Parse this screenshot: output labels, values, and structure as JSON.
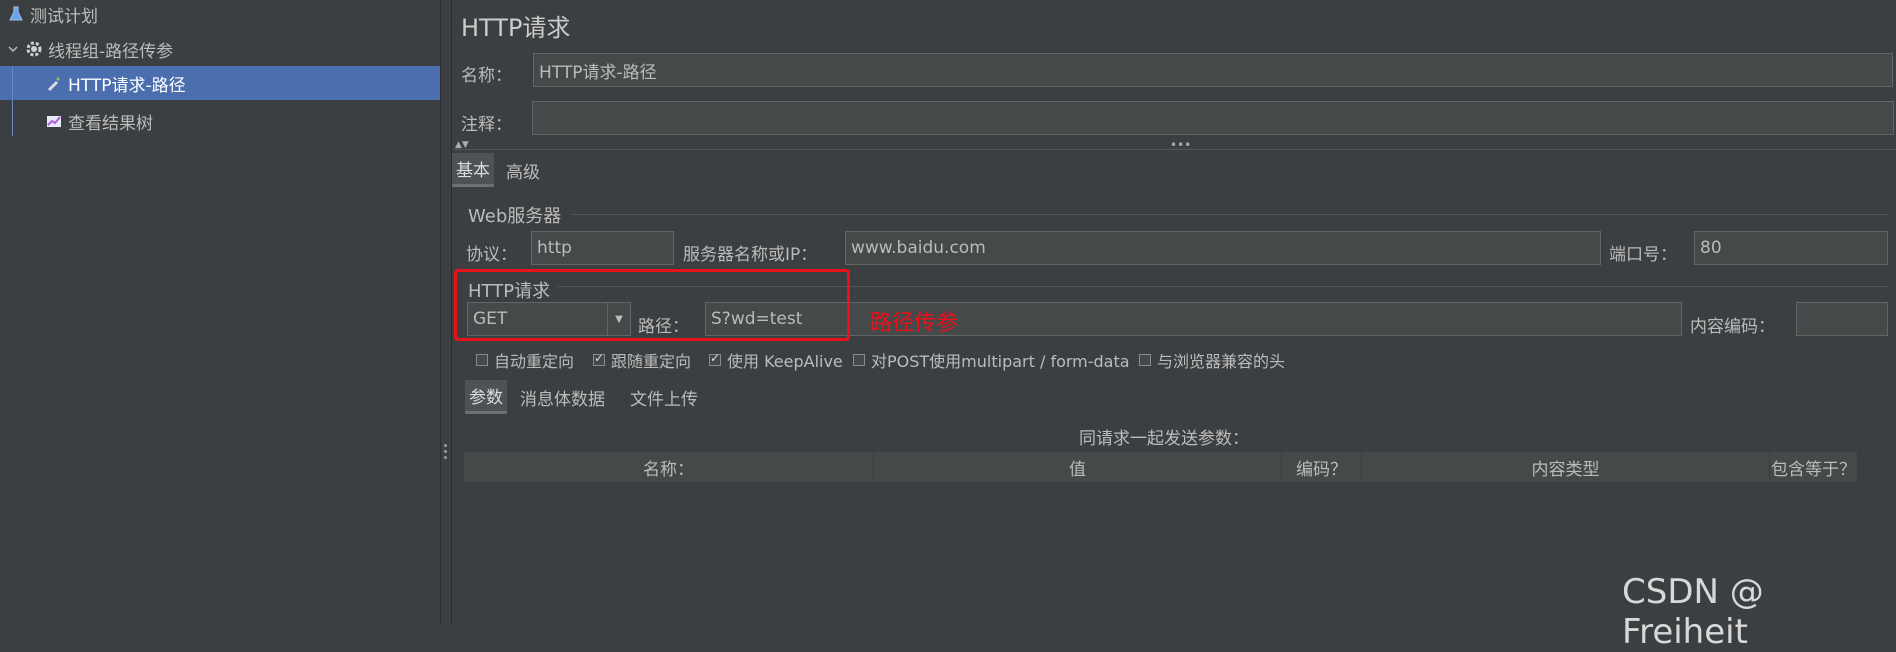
{
  "tree": {
    "items": [
      {
        "label": "测试计划",
        "icon": "flask-icon"
      },
      {
        "label": "线程组-路径传参",
        "icon": "gear-icon",
        "expander": "chevron-down-icon"
      },
      {
        "label": "HTTP请求-路径",
        "icon": "pipette-icon",
        "selected": true
      },
      {
        "label": "查看结果树",
        "icon": "chart-icon"
      }
    ]
  },
  "panel": {
    "title": "HTTP请求",
    "name_label": "名称：",
    "name_value": "HTTP请求-路径",
    "comment_label": "注释：",
    "comment_value": "",
    "tabs": [
      {
        "label": "基本",
        "active": true
      },
      {
        "label": "高级",
        "active": false
      }
    ]
  },
  "web_server": {
    "section_title": "Web服务器",
    "protocol_label": "协议：",
    "protocol_value": "http",
    "server_label": "服务器名称或IP：",
    "server_value": "www.baidu.com",
    "port_label": "端口号：",
    "port_value": "80"
  },
  "http_request": {
    "section_title": "HTTP请求",
    "method_value": "GET",
    "path_label": "路径：",
    "path_value": "S?wd=test",
    "encoding_label": "内容编码：",
    "encoding_value": "",
    "annotation": "路径传参"
  },
  "options": [
    {
      "label": "自动重定向",
      "checked": false
    },
    {
      "label": "跟随重定向",
      "checked": true
    },
    {
      "label": "使用 KeepAlive",
      "checked": true
    },
    {
      "label": "对POST使用multipart / form-data",
      "checked": false
    },
    {
      "label": "与浏览器兼容的头",
      "checked": false
    }
  ],
  "sub_tabs": [
    {
      "label": "参数",
      "active": true
    },
    {
      "label": "消息体数据",
      "active": false
    },
    {
      "label": "文件上传",
      "active": false
    }
  ],
  "params": {
    "caption": "同请求一起发送参数：",
    "columns": [
      "名称：",
      "值",
      "编码？",
      "内容类型",
      "包含等于？"
    ]
  },
  "watermark": "CSDN @ Freiheit",
  "colors": {
    "selection": "#4b6eaf",
    "annotation": "#e8121b",
    "background": "#3c3f41"
  }
}
